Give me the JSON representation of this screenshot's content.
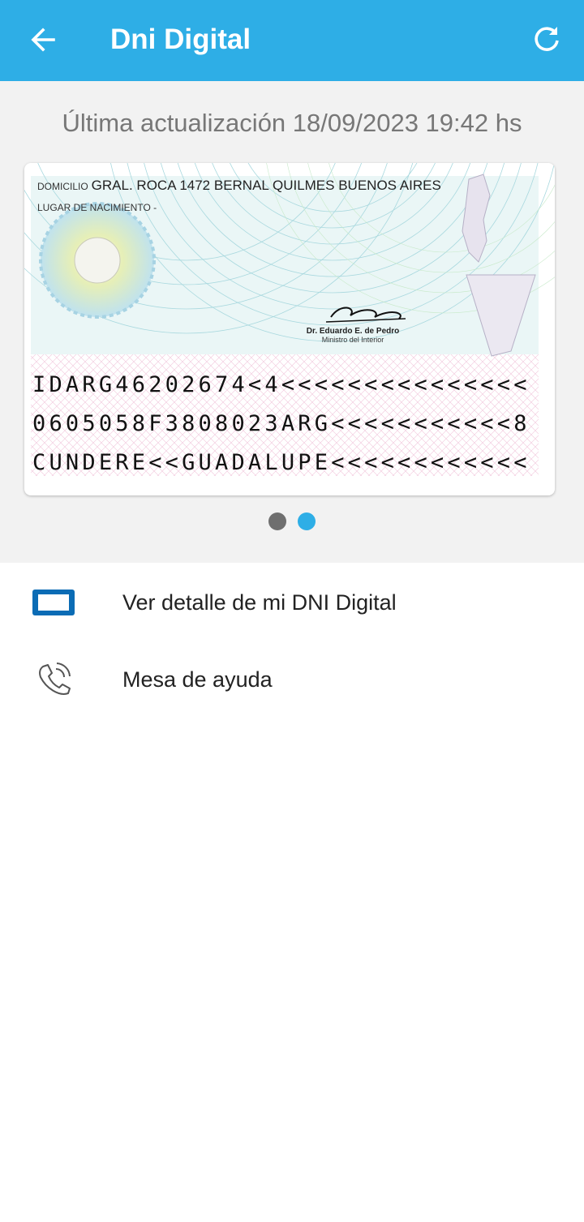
{
  "appbar": {
    "title": "Dni Digital",
    "back_icon": "arrow-left-icon",
    "refresh_icon": "refresh-icon",
    "color": "#2eaee6"
  },
  "last_update": "Última actualización 18/09/2023 19:42 hs",
  "card": {
    "address_label": "DOMICILIO",
    "address": "GRAL. ROCA 1472 BERNAL QUILMES BUENOS AIRES",
    "birthplace_label": "LUGAR DE NACIMIENTO -",
    "signature_name": "Dr. Eduardo E. de Pedro",
    "signature_role": "Ministro del Interior",
    "signature_script": "EdePedro",
    "mrz": [
      "IDARG46202674<4<<<<<<<<<<<<<<<",
      "0605058F3808023ARG<<<<<<<<<<<8",
      "CUNDERE<<GUADALUPE<<<<<<<<<<<<"
    ]
  },
  "carousel": {
    "pages": 2,
    "active_index": 1
  },
  "menu": [
    {
      "label": "Ver detalle de mi DNI Digital",
      "icon": "id-card-icon"
    },
    {
      "label": "Mesa de ayuda",
      "icon": "phone-icon"
    }
  ]
}
